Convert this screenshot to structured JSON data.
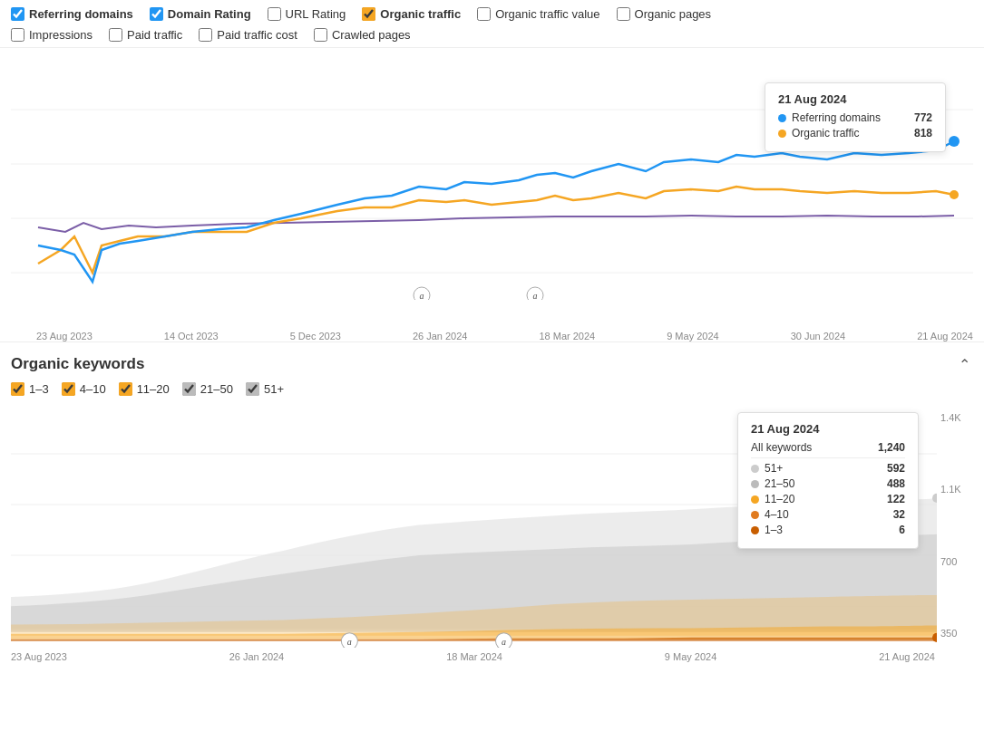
{
  "filters": {
    "row1": [
      {
        "id": "referring-domains",
        "label": "Referring domains",
        "checked": true,
        "bold": true,
        "color": "blue"
      },
      {
        "id": "domain-rating",
        "label": "Domain Rating",
        "checked": true,
        "bold": true,
        "color": "blue"
      },
      {
        "id": "url-rating",
        "label": "URL Rating",
        "checked": false,
        "bold": false,
        "color": "default"
      },
      {
        "id": "organic-traffic",
        "label": "Organic traffic",
        "checked": true,
        "bold": true,
        "color": "orange"
      },
      {
        "id": "organic-traffic-value",
        "label": "Organic traffic value",
        "checked": false,
        "bold": false,
        "color": "default"
      },
      {
        "id": "organic-pages",
        "label": "Organic pages",
        "checked": false,
        "bold": false,
        "color": "default"
      }
    ],
    "row2": [
      {
        "id": "impressions",
        "label": "Impressions",
        "checked": false,
        "bold": false,
        "color": "default"
      },
      {
        "id": "paid-traffic",
        "label": "Paid traffic",
        "checked": false,
        "bold": false,
        "color": "default"
      },
      {
        "id": "paid-traffic-cost",
        "label": "Paid traffic cost",
        "checked": false,
        "bold": false,
        "color": "default"
      },
      {
        "id": "crawled-pages",
        "label": "Crawled pages",
        "checked": false,
        "bold": false,
        "color": "default"
      }
    ]
  },
  "chart1": {
    "x_labels": [
      "23 Aug 2023",
      "14 Oct 2023",
      "5 Dec 2023",
      "26 Jan 2024",
      "18 Mar 2024",
      "9 May 2024",
      "30 Jun 2024",
      "21 Aug 2024"
    ],
    "tooltip": {
      "date": "21 Aug 2024",
      "rows": [
        {
          "label": "Referring domains",
          "value": "772",
          "color": "blue"
        },
        {
          "label": "Organic traffic",
          "value": "818",
          "color": "orange"
        }
      ]
    }
  },
  "organic_keywords": {
    "section_title": "Organic keywords",
    "filters": [
      {
        "id": "kw-1-3",
        "label": "1–3",
        "checked": true,
        "color": "#f5a623"
      },
      {
        "id": "kw-4-10",
        "label": "4–10",
        "checked": true,
        "color": "#f5a623"
      },
      {
        "id": "kw-11-20",
        "label": "11–20",
        "checked": true,
        "color": "#f5a623"
      },
      {
        "id": "kw-21-50",
        "label": "21–50",
        "checked": true,
        "color": "#bbb"
      },
      {
        "id": "kw-51plus",
        "label": "51+",
        "checked": true,
        "color": "#bbb"
      }
    ],
    "tooltip": {
      "date": "21 Aug 2024",
      "all_keywords_label": "All keywords",
      "all_keywords_value": "1,240",
      "rows": [
        {
          "label": "51+",
          "value": "592",
          "color": "#ccc"
        },
        {
          "label": "21–50",
          "value": "488",
          "color": "#bbb"
        },
        {
          "label": "11–20",
          "value": "122",
          "color": "#f5a623"
        },
        {
          "label": "4–10",
          "value": "32",
          "color": "#e07b20"
        },
        {
          "label": "1–3",
          "value": "6",
          "color": "#c85e00"
        }
      ]
    },
    "y_labels": [
      "1.4K",
      "1.1K",
      "700",
      "350"
    ]
  },
  "chart2_x_labels": [
    "23 Aug 2023",
    "26 Jan 2024",
    "18 Mar 2024",
    "9 May 2024",
    "21 Aug 2024"
  ]
}
